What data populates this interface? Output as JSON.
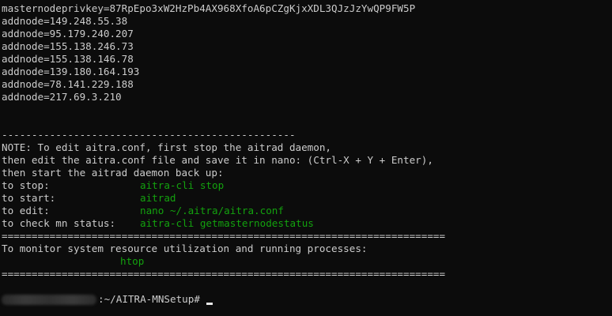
{
  "terminal": {
    "masternode_line": "masternodeprivkey=87RpEpo3xW2HzPb4AX968XfoA6pCZgKjxXDL3QJzJzYwQP9FW5P",
    "addnodes": [
      "addnode=149.248.55.38",
      "addnode=95.179.240.207",
      "addnode=155.138.246.73",
      "addnode=155.138.146.78",
      "addnode=139.180.164.193",
      "addnode=78.141.229.188",
      "addnode=217.69.3.210"
    ],
    "dash_separator": "-------------------------------------------------",
    "note_lines": [
      "NOTE: To edit aitra.conf, first stop the aitrad daemon,",
      "then edit the aitra.conf file and save it in nano: (Ctrl-X + Y + Enter),",
      "then start the aitrad daemon back up:"
    ],
    "commands": [
      {
        "label": "to stop:",
        "command": "aitra-cli stop"
      },
      {
        "label": "to start:",
        "command": "aitrad"
      },
      {
        "label": "to edit:",
        "command": "nano ~/.aitra/aitra.conf"
      },
      {
        "label": "to check mn status:",
        "command": "aitra-cli getmasternodestatus"
      }
    ],
    "equals_separator": "==========================================================================",
    "monitor_text": "To monitor system resource utilization and running processes:",
    "monitor_command": "htop",
    "prompt_path": ":~/AITRA-MNSetup#"
  }
}
